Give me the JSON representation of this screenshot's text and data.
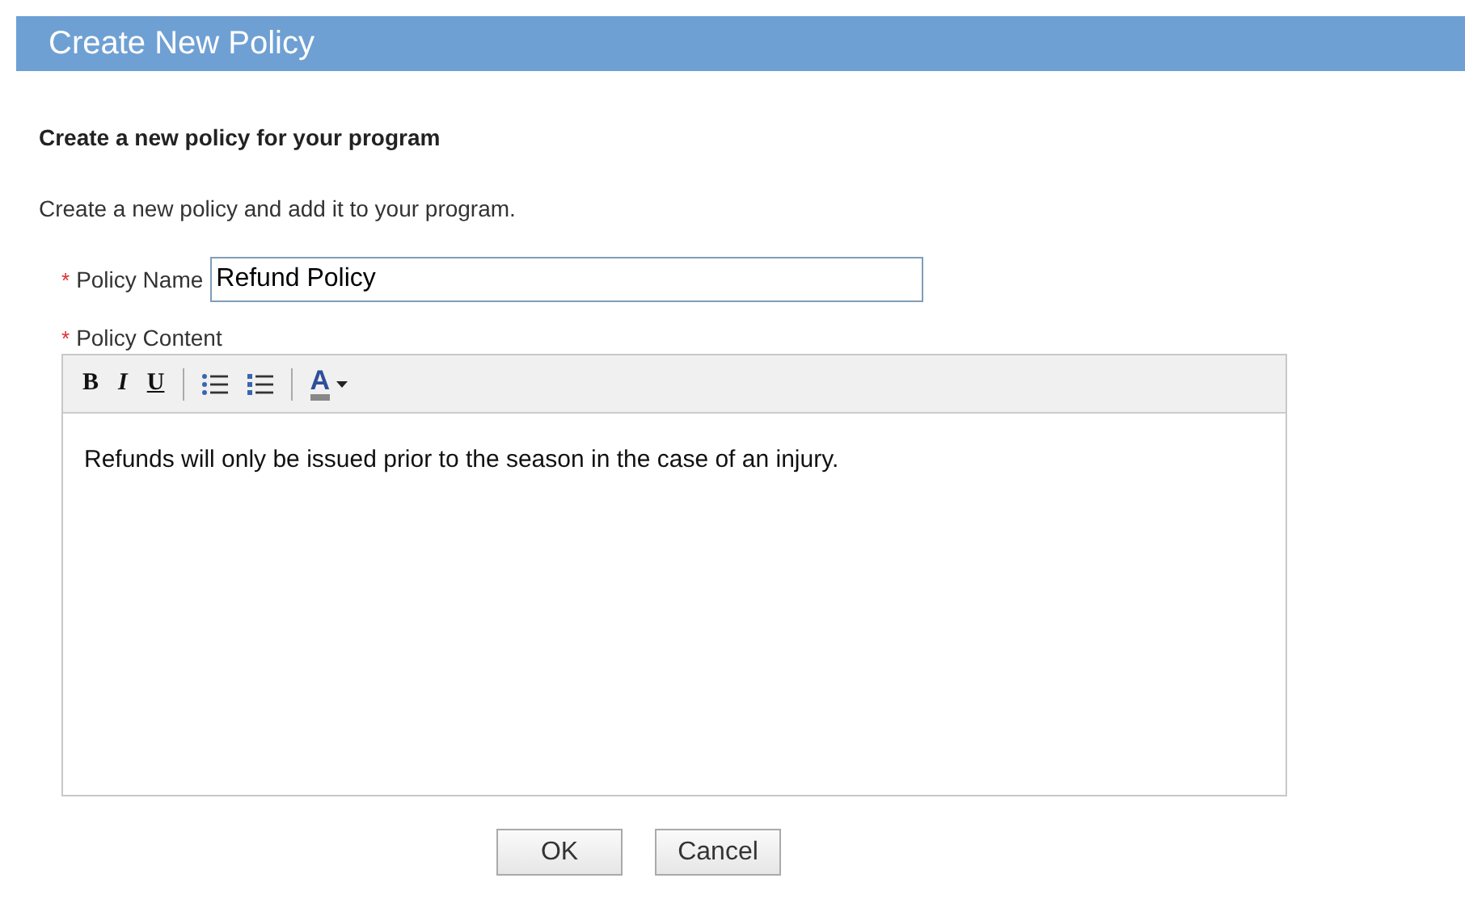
{
  "dialog": {
    "title": "Create New Policy"
  },
  "heading": "Create a new policy for your program",
  "description": "Create a new policy and add it to your program.",
  "name_field": {
    "marker": "*",
    "label": "Policy Name",
    "value": "Refund Policy"
  },
  "content_field": {
    "marker": "*",
    "label": "Policy Content",
    "value": "Refunds will only be issued prior to the season in the case of an injury."
  },
  "toolbar": [
    {
      "kind": "bold",
      "label": "B"
    },
    {
      "kind": "italic",
      "label": "I"
    },
    {
      "kind": "underline",
      "label": "U"
    },
    {
      "kind": "separator"
    },
    {
      "kind": "bullets"
    },
    {
      "kind": "numbers"
    },
    {
      "kind": "separator"
    },
    {
      "kind": "font-color",
      "label": "A"
    }
  ],
  "buttons": [
    {
      "label": "OK"
    },
    {
      "label": "Cancel"
    }
  ]
}
